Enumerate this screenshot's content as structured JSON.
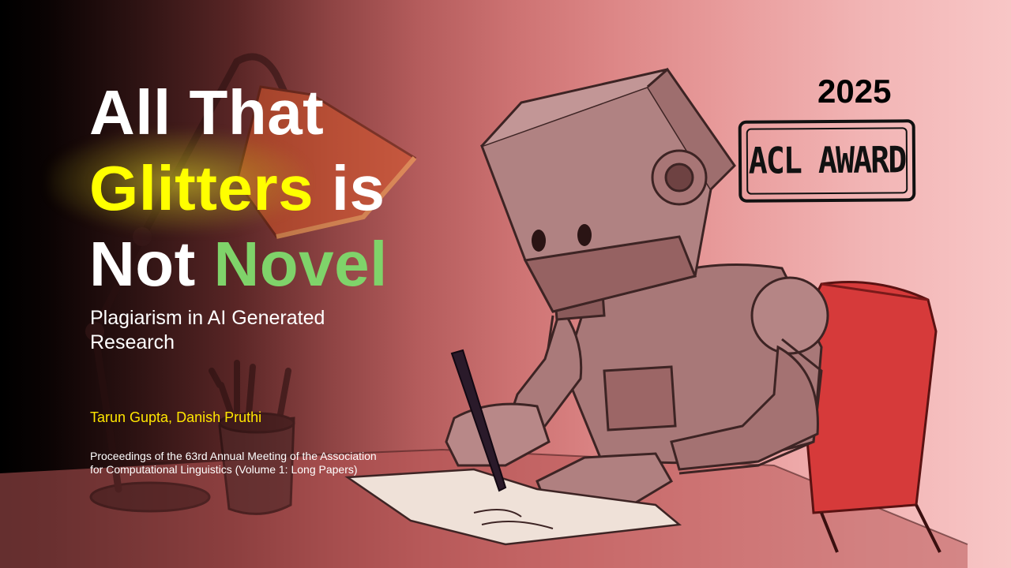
{
  "title": {
    "line1": "All That",
    "line2_highlight": "Glitters",
    "line2_rest": " is",
    "line3_plain": "Not ",
    "line3_highlight": "Novel"
  },
  "subtitle": "Plagiarism in AI Generated Research",
  "authors": "Tarun Gupta, Danish Pruthi",
  "venue": "Proceedings of the 63rd Annual Meeting of the Association for Computational Linguistics (Volume 1: Long Papers)",
  "award": {
    "year": "2025",
    "label": "ACL AWARD"
  },
  "colors": {
    "title": "#ffffff",
    "highlight_yellow": "#ffff00",
    "highlight_green": "#7fd36a",
    "authors": "#ffe600",
    "stamp": "#111111"
  },
  "illustration": {
    "description_icons": [
      "robot-icon",
      "desk-lamp-icon",
      "pencil-cup-icon",
      "pen-icon",
      "notebook-icon",
      "chair-icon"
    ]
  }
}
